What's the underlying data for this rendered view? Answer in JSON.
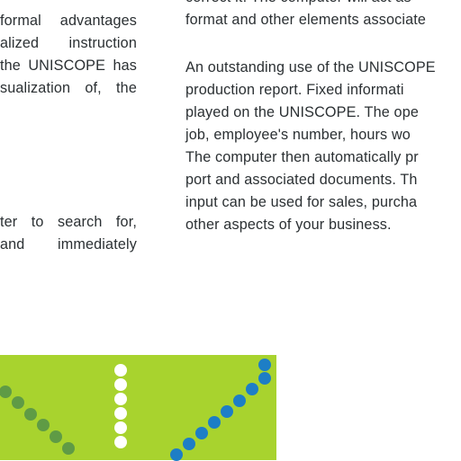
{
  "left_column": {
    "para1": [
      "formal advantages",
      "alized instruction",
      "the UNISCOPE has",
      "sualization of, the"
    ],
    "para2": [
      "ter to search for,",
      "and immediately"
    ]
  },
  "right_column": {
    "para1": [
      "correct it. The computer will act as",
      "format and other elements associate"
    ],
    "para2": [
      "An outstanding use of the UNISCOPE",
      "production report. Fixed informati",
      "played on the UNISCOPE. The ope",
      "job, employee's number, hours wo",
      "The computer then automatically pr",
      "port and associated documents. Th",
      "input can be used for sales, purcha",
      "other aspects of your business."
    ]
  },
  "graphic": {
    "background_color": "#a8d32e",
    "dot_colors": {
      "green": "#5f9b45",
      "white": "#ffffff",
      "blue": "#1d7ec6"
    }
  }
}
